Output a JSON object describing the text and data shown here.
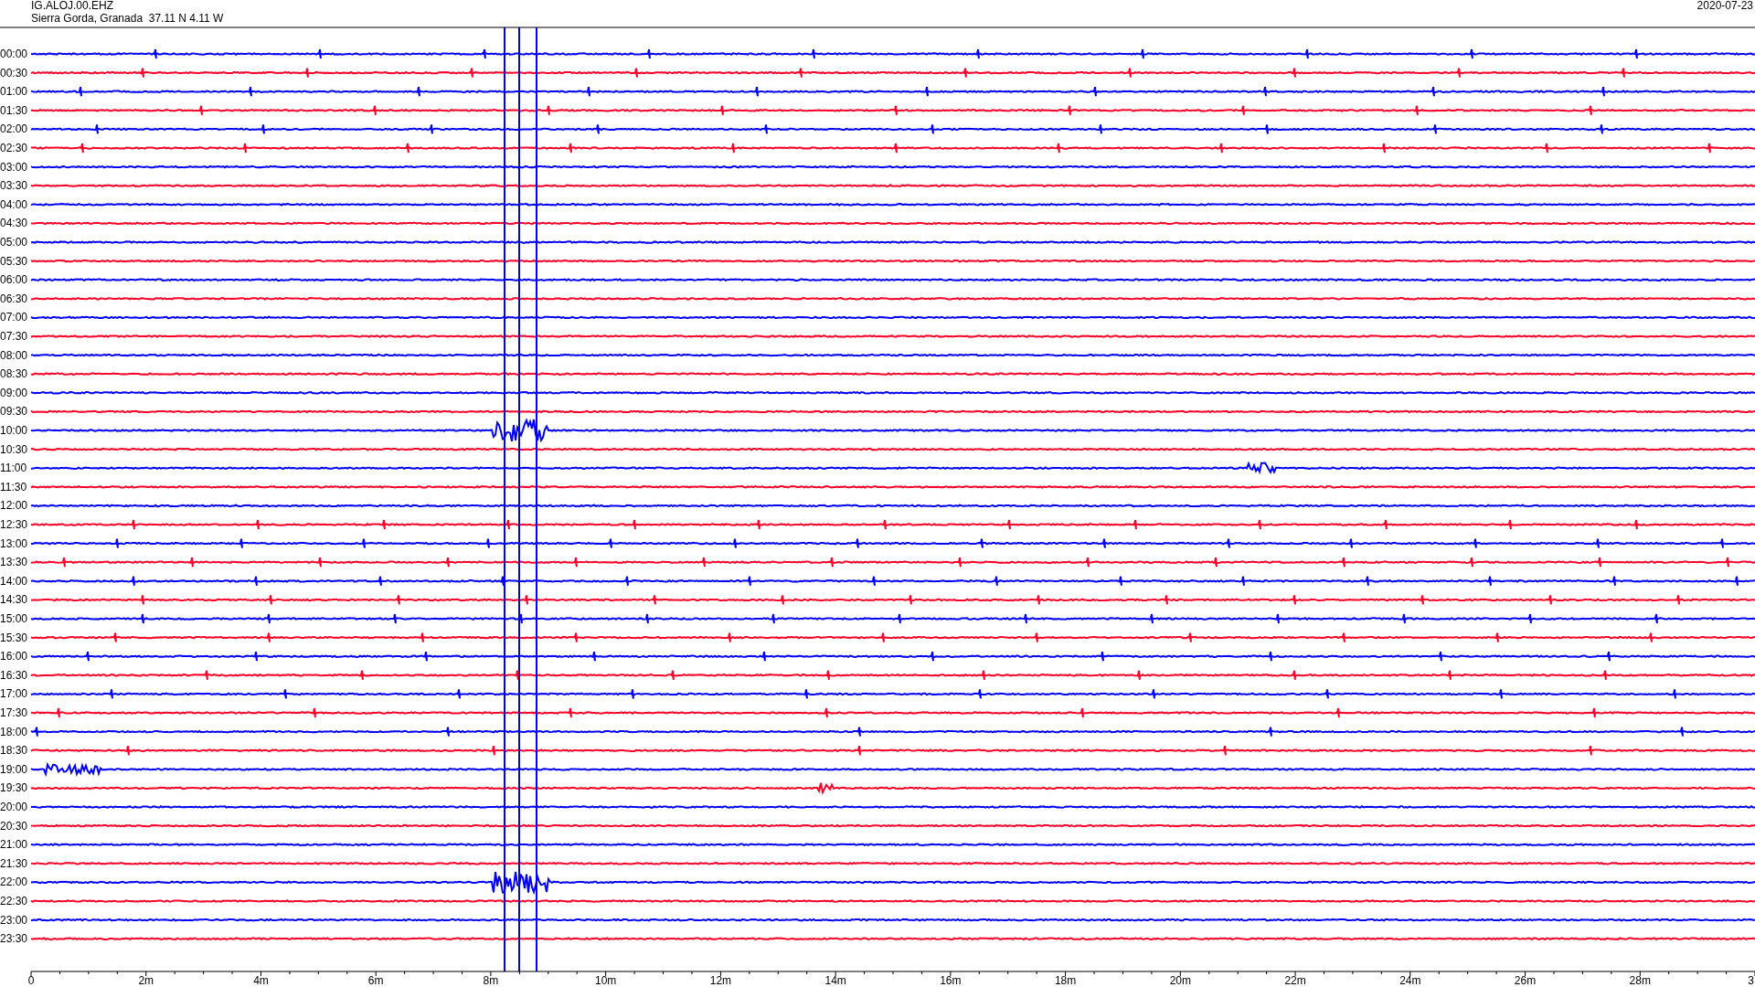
{
  "header": {
    "station": "IG.ALOJ.00.EHZ",
    "location": "Sierra Gorda, Granada  37.11 N 4.11 W",
    "date": "2020-07-23"
  },
  "rows": [
    {
      "time": "00:00",
      "color": "#0000ff"
    },
    {
      "time": "00:30",
      "color": "#ff0028"
    },
    {
      "time": "01:00",
      "color": "#0000ff"
    },
    {
      "time": "01:30",
      "color": "#ff0028"
    },
    {
      "time": "02:00",
      "color": "#0000ff"
    },
    {
      "time": "02:30",
      "color": "#ff0028"
    },
    {
      "time": "03:00",
      "color": "#0000ff"
    },
    {
      "time": "03:30",
      "color": "#ff0028"
    },
    {
      "time": "04:00",
      "color": "#0000ff"
    },
    {
      "time": "04:30",
      "color": "#ff0028"
    },
    {
      "time": "05:00",
      "color": "#0000ff"
    },
    {
      "time": "05:30",
      "color": "#ff0028"
    },
    {
      "time": "06:00",
      "color": "#0000ff"
    },
    {
      "time": "06:30",
      "color": "#ff0028"
    },
    {
      "time": "07:00",
      "color": "#0000ff"
    },
    {
      "time": "07:30",
      "color": "#ff0028"
    },
    {
      "time": "08:00",
      "color": "#0000ff"
    },
    {
      "time": "08:30",
      "color": "#ff0028"
    },
    {
      "time": "09:00",
      "color": "#0000ff"
    },
    {
      "time": "09:30",
      "color": "#ff0028"
    },
    {
      "time": "10:00",
      "color": "#0000ff"
    },
    {
      "time": "10:30",
      "color": "#ff0028"
    },
    {
      "time": "11:00",
      "color": "#0000ff"
    },
    {
      "time": "11:30",
      "color": "#ff0028"
    },
    {
      "time": "12:00",
      "color": "#0000ff"
    },
    {
      "time": "12:30",
      "color": "#ff0028"
    },
    {
      "time": "13:00",
      "color": "#0000ff"
    },
    {
      "time": "13:30",
      "color": "#ff0028"
    },
    {
      "time": "14:00",
      "color": "#0000ff"
    },
    {
      "time": "14:30",
      "color": "#ff0028"
    },
    {
      "time": "15:00",
      "color": "#0000ff"
    },
    {
      "time": "15:30",
      "color": "#ff0028"
    },
    {
      "time": "16:00",
      "color": "#0000ff"
    },
    {
      "time": "16:30",
      "color": "#ff0028"
    },
    {
      "time": "17:00",
      "color": "#0000ff"
    },
    {
      "time": "17:30",
      "color": "#ff0028"
    },
    {
      "time": "18:00",
      "color": "#0000ff"
    },
    {
      "time": "18:30",
      "color": "#ff0028"
    },
    {
      "time": "19:00",
      "color": "#0000ff"
    },
    {
      "time": "19:30",
      "color": "#ff0028"
    },
    {
      "time": "20:00",
      "color": "#0000ff"
    },
    {
      "time": "20:30",
      "color": "#ff0028"
    },
    {
      "time": "21:00",
      "color": "#0000ff"
    },
    {
      "time": "21:30",
      "color": "#ff0028"
    },
    {
      "time": "22:00",
      "color": "#0000ff"
    },
    {
      "time": "22:30",
      "color": "#ff0028"
    },
    {
      "time": "23:00",
      "color": "#0000ff"
    },
    {
      "time": "23:30",
      "color": "#ff0028"
    }
  ],
  "x_axis": {
    "ticks": [
      "0",
      "2m",
      "4m",
      "6m",
      "8m",
      "10m",
      "12m",
      "14m",
      "16m",
      "18m",
      "20m",
      "22m",
      "24m",
      "26m",
      "28m",
      "3"
    ]
  }
}
